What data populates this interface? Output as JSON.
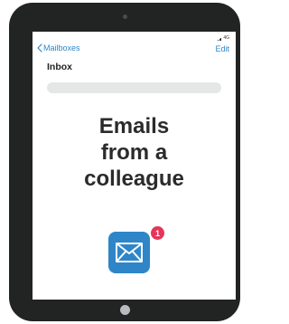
{
  "status_bar": {
    "network": "4G"
  },
  "nav": {
    "back_label": "Mailboxes",
    "edit_label": "Edit"
  },
  "page": {
    "title": "Inbox"
  },
  "headline": {
    "line1": "Emails",
    "line2": "from a",
    "line3": "colleague"
  },
  "mail_app": {
    "icon": "envelope-icon",
    "badge_count": "1",
    "color": "#2e86c9",
    "badge_color": "#e3365a"
  },
  "colors": {
    "device_frame": "#222323",
    "accent": "#2f86c8"
  }
}
